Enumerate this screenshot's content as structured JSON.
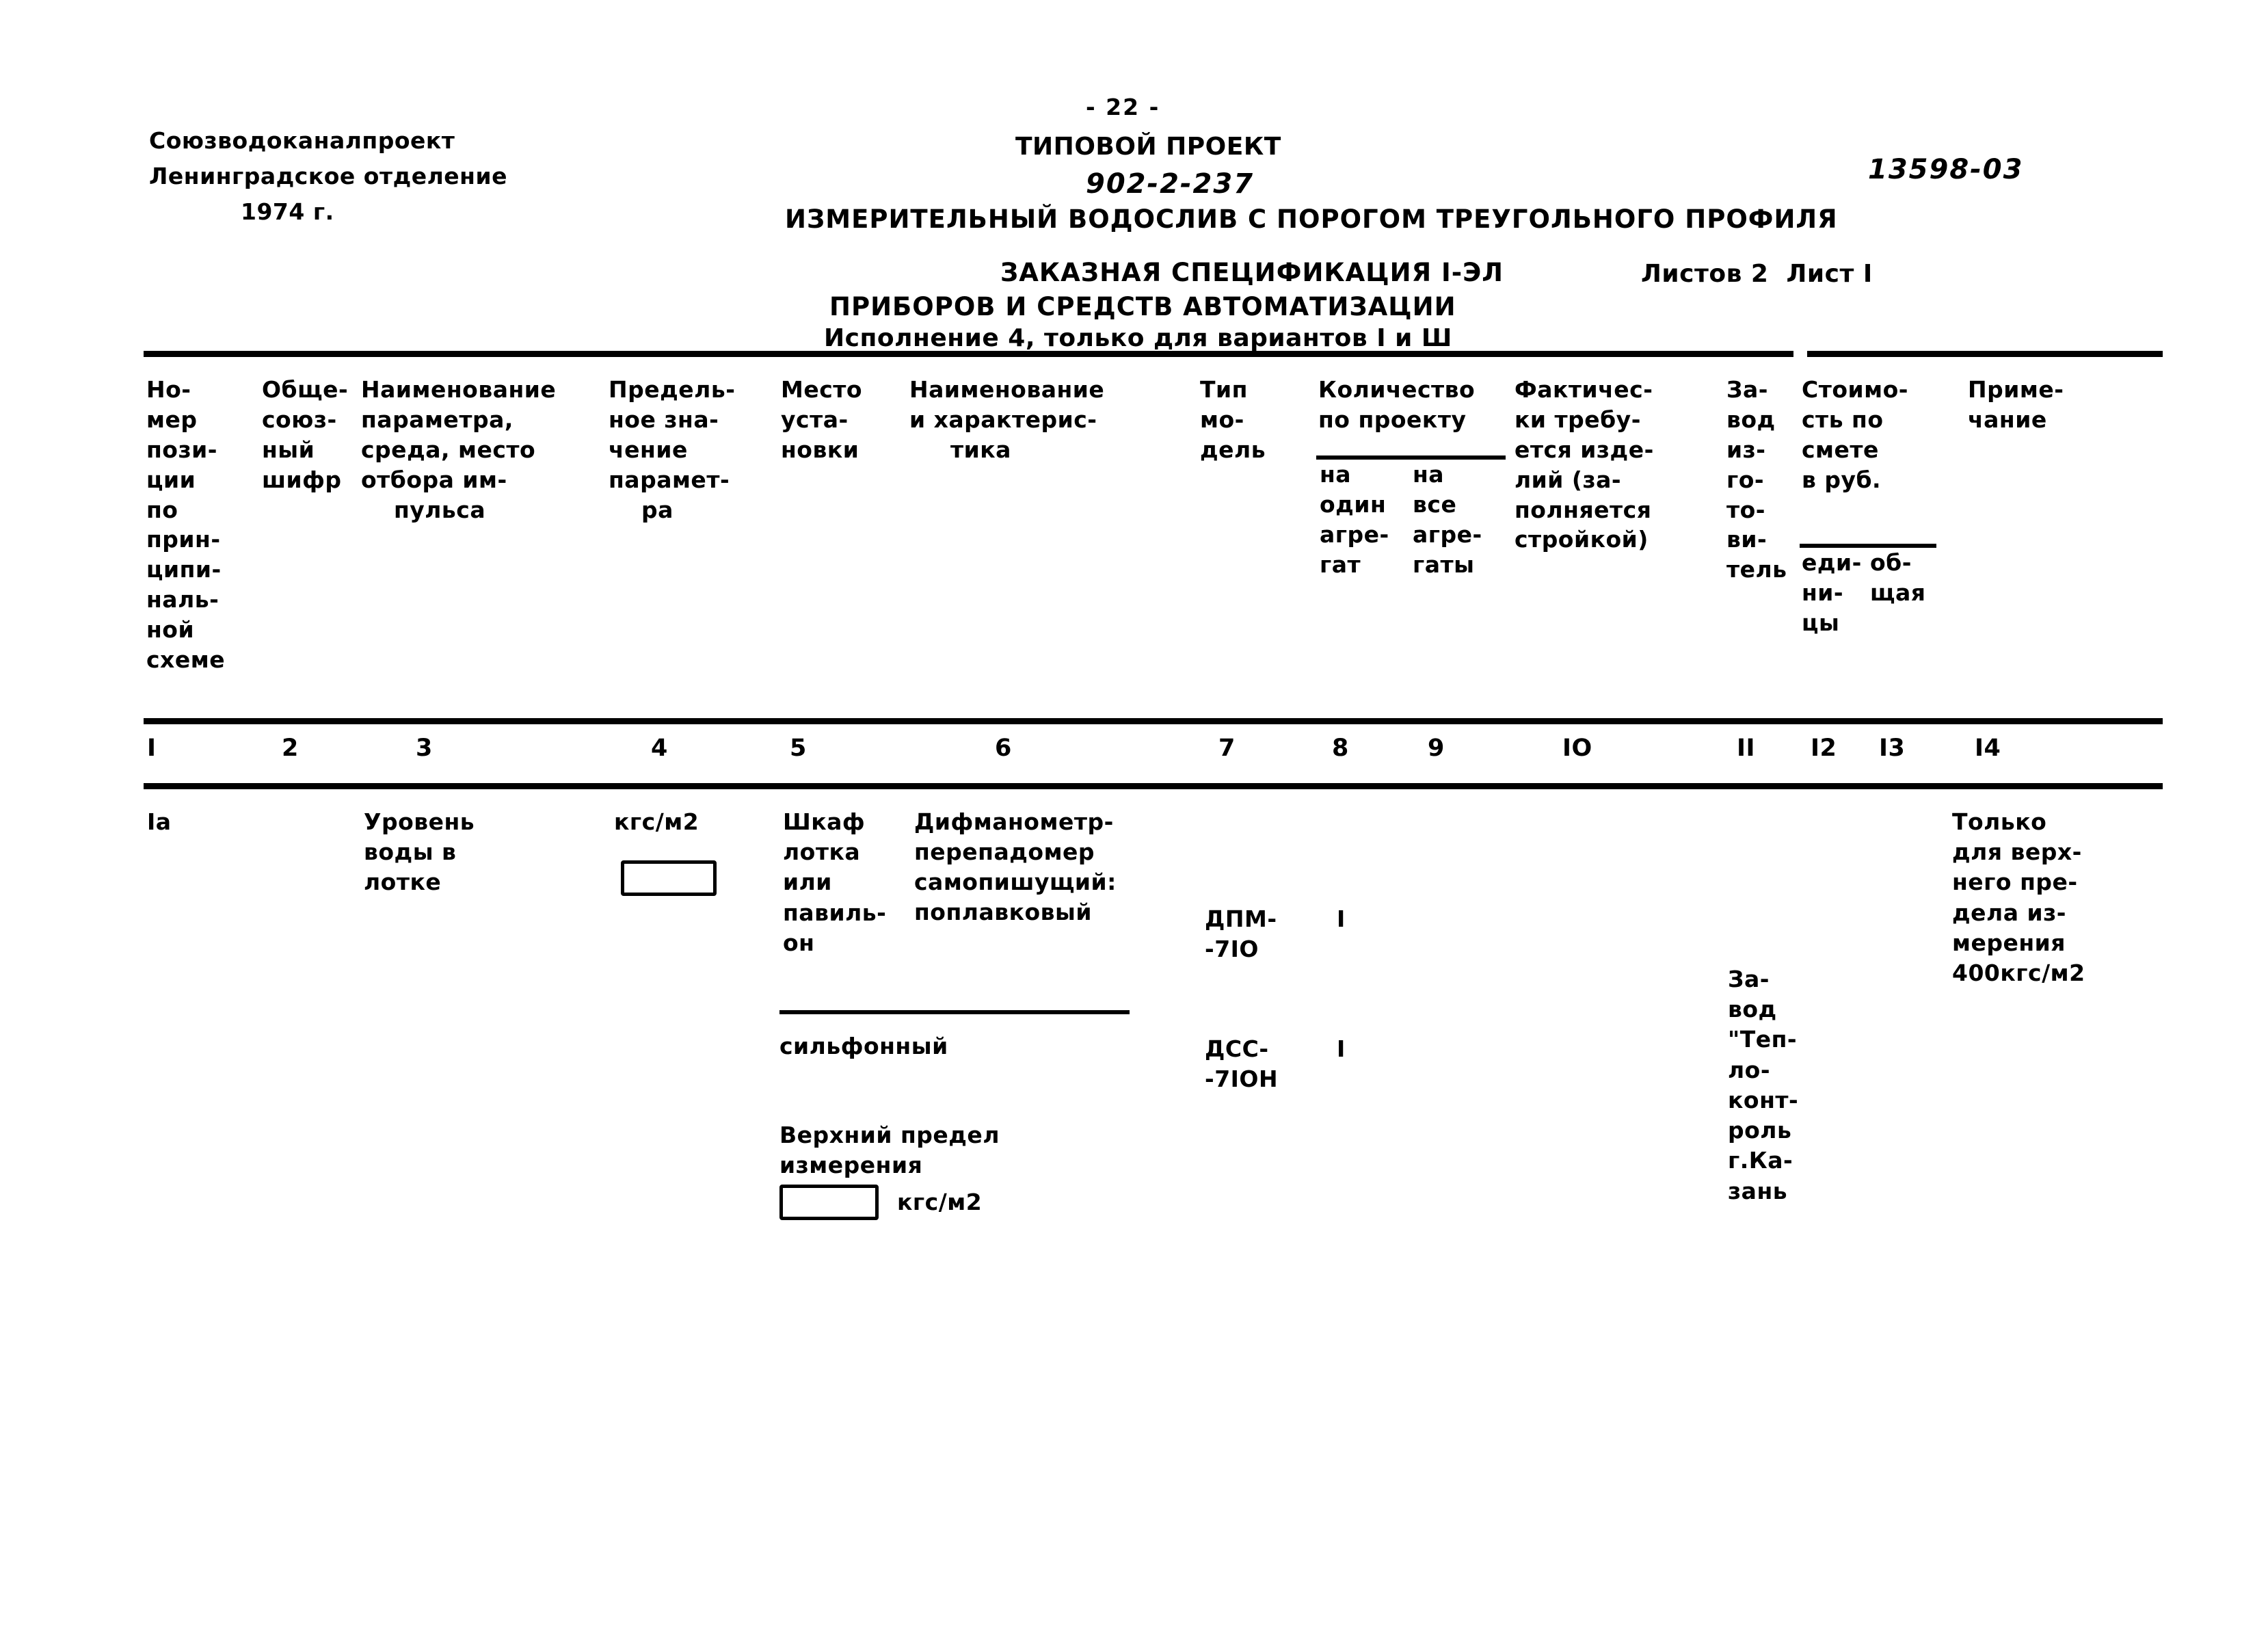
{
  "document": {
    "page_number": "- 22 -",
    "organization": {
      "line1": "Союзводоканалпроект",
      "line2": "Ленинградское отделение",
      "line3": "1974 г."
    },
    "project_label": "ТИПОВОЙ ПРОЕКТ",
    "project_number": "902-2-237",
    "project_title": "ИЗМЕРИТЕЛЬНЫЙ ВОДОСЛИВ С ПОРОГОМ ТРЕУГОЛЬНОГО ПРОФИЛЯ",
    "spec_title_line1": "ЗАКАЗНАЯ СПЕЦИФИКАЦИЯ I-ЭЛ",
    "spec_title_line2": "ПРИБОРОВ И СРЕДСТВ АВТОМАТИЗАЦИИ",
    "variant_note": "Исполнение 4, только для вариантов I и Ш",
    "sheets_label": "Листов 2  Лист I",
    "drawing_code": "13598-03"
  },
  "table": {
    "headers": {
      "col1": "Но-\nмер\nпози-\nции\nпо\nприн-\nципи-\nналь-\nной\nсхеме",
      "col2": "Обще-\nсоюз-\nный\nшифр",
      "col3": "Наименование\nпараметра,\nсреда, место\nотбора им-\n    пульса",
      "col4": "Предель-\nное зна-\nчение\nпарамет-\n    ра",
      "col5": "Место\nуста-\nновки",
      "col6": "Наименование\nи характерис-\n     тика",
      "col7": "Тип\nмо-\nдель",
      "col8_10_title": "Количество\nпо проекту",
      "col8": "на\nодин\nагре-\nгат",
      "col9": "на\nвсе\nагре-\nгаты",
      "col10": "Фактичес-\nки требу-\nется изде-\nлий (за-\nполняется\nстройкой)",
      "col11": "За-\nвод\nиз-\nго-\nто-\nви-\nтель",
      "col12_13_title": "Стоимо-\nсть по\nсмете\nв руб.",
      "col12": "еди-\nни-\nцы",
      "col13": "об-\nщая",
      "col14": "Приме-\nчание"
    },
    "column_numbers": [
      "I",
      "2",
      "3",
      "4",
      "5",
      "6",
      "7",
      "8",
      "9",
      "IO",
      "II",
      "I2",
      "I3",
      "I4"
    ],
    "rows": [
      {
        "position": "Iа",
        "common_code": "",
        "parameter": "Уровень\nводы в\nлотке",
        "limit_unit": "кгс/м2",
        "limit_value": "",
        "install_place": "Шкаф\nлотка\nили\nпавиль-\nон",
        "name_line1": "Дифманометр-",
        "name_line2": "перепадомер",
        "name_line3": "самопишущий:",
        "name_item1": "поплавковый",
        "name_item2": "сильфонный",
        "name_note_line1": "Верхний предел",
        "name_note_line2": "измерения",
        "name_note_value": "",
        "name_note_unit": "кгс/м2",
        "type_model_1": "ДПМ-\n-7IO",
        "type_model_2": "ДСС-\n-7IOН",
        "qty_per_unit_1": "I",
        "qty_per_unit_2": "I",
        "manufacturer": "За-\nвод\n\"Теп-\nло-\nконт-\nроль\nг.Ка-\nзань",
        "note": "Только\nдля верх-\nнего пре-\nдела из-\nмерения\n400кгс/м2"
      }
    ]
  }
}
